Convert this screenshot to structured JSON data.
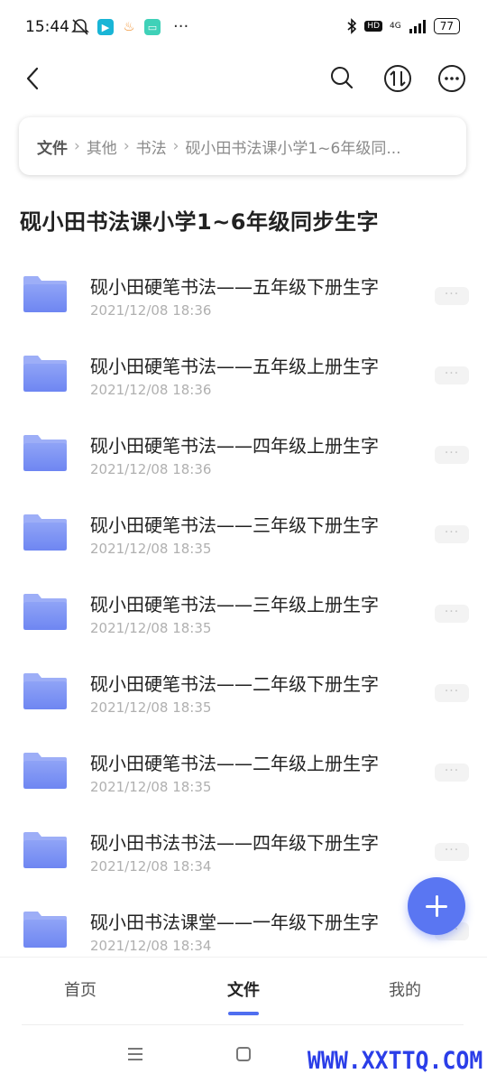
{
  "status_bar": {
    "time": "15:44",
    "dots": "···",
    "hd": "HD",
    "network": "4G",
    "battery": "77"
  },
  "breadcrumb": {
    "root": "文件",
    "items": [
      "其他",
      "书法",
      "砚小田书法课小学1~6年级同..."
    ]
  },
  "page_title": "砚小田书法课小学1~6年级同步生字",
  "folders": [
    {
      "name": "砚小田硬笔书法——五年级下册生字",
      "date": "2021/12/08 18:36"
    },
    {
      "name": "砚小田硬笔书法——五年级上册生字",
      "date": "2021/12/08 18:36"
    },
    {
      "name": "砚小田硬笔书法——四年级上册生字",
      "date": "2021/12/08 18:36"
    },
    {
      "name": "砚小田硬笔书法——三年级下册生字",
      "date": "2021/12/08 18:35"
    },
    {
      "name": "砚小田硬笔书法——三年级上册生字",
      "date": "2021/12/08 18:35"
    },
    {
      "name": "砚小田硬笔书法——二年级下册生字",
      "date": "2021/12/08 18:35"
    },
    {
      "name": "砚小田硬笔书法——二年级上册生字",
      "date": "2021/12/08 18:35"
    },
    {
      "name": "砚小田书法书法——四年级下册生字",
      "date": "2021/12/08 18:34"
    },
    {
      "name": "砚小田书法课堂——一年级下册生字",
      "date": "2021/12/08 18:34"
    }
  ],
  "more_label": "···",
  "bottom_nav": {
    "home": "首页",
    "files": "文件",
    "mine": "我的"
  },
  "watermark": "WWW.XXTTQ.COM",
  "colors": {
    "accent": "#5a76f2",
    "folder_top": "#8fa3f6",
    "folder_bottom": "#6e86f2"
  }
}
